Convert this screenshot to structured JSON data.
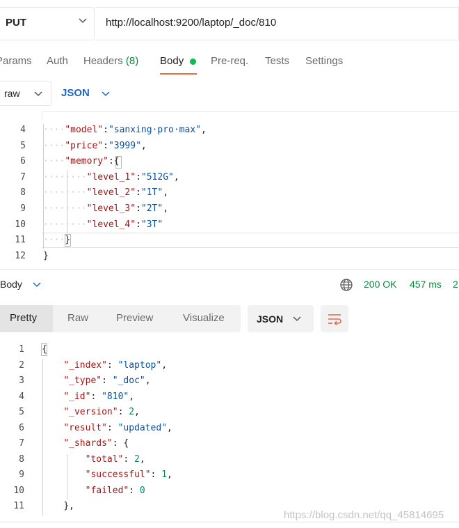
{
  "request": {
    "method": "PUT",
    "url": "http://localhost:9200/laptop/_doc/810"
  },
  "tabs": [
    {
      "label": "Params"
    },
    {
      "label": "Auth"
    },
    {
      "label": "Headers",
      "count": "(8)"
    },
    {
      "label": "Body"
    },
    {
      "label": "Pre-req."
    },
    {
      "label": "Tests"
    },
    {
      "label": "Settings"
    }
  ],
  "body_mode": {
    "type": "raw",
    "format": "JSON"
  },
  "editor": {
    "line_numbers": [
      "4",
      "5",
      "6",
      "7",
      "8",
      "9",
      "10",
      "11",
      "12"
    ],
    "lines": [
      {
        "indent": "····",
        "key": "\"model\"",
        "colon": ":",
        "value": "\"sanxing·pro·max\"",
        "tail": ","
      },
      {
        "indent": "····",
        "key": "\"price\"",
        "colon": ":",
        "value": "\"3999\"",
        "tail": ","
      },
      {
        "indent": "····",
        "key": "\"memory\"",
        "colon": ":",
        "value": "",
        "tail": "{"
      },
      {
        "indent": "········",
        "key": "\"level_1\"",
        "colon": ":",
        "value": "\"512G\"",
        "tail": ","
      },
      {
        "indent": "········",
        "key": "\"level_2\"",
        "colon": ":",
        "value": "\"1T\"",
        "tail": ","
      },
      {
        "indent": "········",
        "key": "\"level_3\"",
        "colon": ":",
        "value": "\"2T\"",
        "tail": ","
      },
      {
        "indent": "········",
        "key": "\"level_4\"",
        "colon": ":",
        "value": "\"3T\"",
        "tail": ""
      },
      {
        "indent": "····",
        "key": "",
        "colon": "",
        "value": "",
        "tail": "}"
      },
      {
        "indent": "",
        "key": "",
        "colon": "",
        "value": "",
        "tail": "}"
      }
    ]
  },
  "response": {
    "section_label": "Body",
    "status": "200 OK",
    "time": "457 ms",
    "size_partial": "2",
    "views": [
      "Pretty",
      "Raw",
      "Preview",
      "Visualize"
    ],
    "active_view": "Pretty",
    "format": "JSON",
    "line_numbers": [
      "1",
      "2",
      "3",
      "4",
      "5",
      "6",
      "7",
      "8",
      "9",
      "10",
      "11"
    ],
    "lines": [
      {
        "indent": "",
        "key": "",
        "colon": "",
        "value": "",
        "vclass": "",
        "tail": "{"
      },
      {
        "indent": "    ",
        "key": "\"_index\"",
        "colon": ": ",
        "value": "\"laptop\"",
        "vclass": "rs",
        "tail": ","
      },
      {
        "indent": "    ",
        "key": "\"_type\"",
        "colon": ": ",
        "value": "\"_doc\"",
        "vclass": "rs",
        "tail": ","
      },
      {
        "indent": "    ",
        "key": "\"_id\"",
        "colon": ": ",
        "value": "\"810\"",
        "vclass": "rs",
        "tail": ","
      },
      {
        "indent": "    ",
        "key": "\"_version\"",
        "colon": ": ",
        "value": "2",
        "vclass": "rn",
        "tail": ","
      },
      {
        "indent": "    ",
        "key": "\"result\"",
        "colon": ": ",
        "value": "\"updated\"",
        "vclass": "rs",
        "tail": ","
      },
      {
        "indent": "    ",
        "key": "\"_shards\"",
        "colon": ": ",
        "value": "",
        "vclass": "",
        "tail": "{"
      },
      {
        "indent": "        ",
        "key": "\"total\"",
        "colon": ": ",
        "value": "2",
        "vclass": "rn",
        "tail": ","
      },
      {
        "indent": "        ",
        "key": "\"successful\"",
        "colon": ": ",
        "value": "1",
        "vclass": "rn",
        "tail": ","
      },
      {
        "indent": "        ",
        "key": "\"failed\"",
        "colon": ": ",
        "value": "0",
        "vclass": "rn",
        "tail": ""
      },
      {
        "indent": "    ",
        "key": "",
        "colon": "",
        "value": "",
        "vclass": "",
        "tail": "},"
      }
    ]
  },
  "watermark": "https://blog.csdn.net/qq_45814695",
  "colors": {
    "accent_underline": "#f26b3a",
    "success": "#0b8a3e",
    "json_link": "#1f63c9",
    "body_dot": "#0cbb52"
  },
  "icons": [
    "chevron-down-icon",
    "globe-icon",
    "wrap-lines-icon"
  ]
}
